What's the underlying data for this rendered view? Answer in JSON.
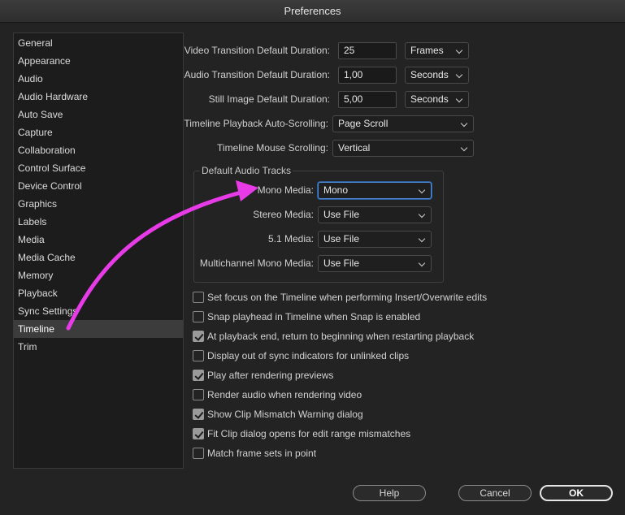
{
  "window": {
    "title": "Preferences"
  },
  "sidebar": {
    "items": [
      {
        "label": "General"
      },
      {
        "label": "Appearance"
      },
      {
        "label": "Audio"
      },
      {
        "label": "Audio Hardware"
      },
      {
        "label": "Auto Save"
      },
      {
        "label": "Capture"
      },
      {
        "label": "Collaboration"
      },
      {
        "label": "Control Surface"
      },
      {
        "label": "Device Control"
      },
      {
        "label": "Graphics"
      },
      {
        "label": "Labels"
      },
      {
        "label": "Media"
      },
      {
        "label": "Media Cache"
      },
      {
        "label": "Memory"
      },
      {
        "label": "Playback"
      },
      {
        "label": "Sync Settings"
      },
      {
        "label": "Timeline"
      },
      {
        "label": "Trim"
      }
    ],
    "selected": "Timeline"
  },
  "durations": {
    "video_transition": {
      "label": "Video Transition Default Duration:",
      "value": "25",
      "unit": "Frames"
    },
    "audio_transition": {
      "label": "Audio Transition Default Duration:",
      "value": "1,00",
      "unit": "Seconds"
    },
    "still_image": {
      "label": "Still Image Default Duration:",
      "value": "5,00",
      "unit": "Seconds"
    }
  },
  "scrolling": {
    "auto_scrolling": {
      "label": "Timeline Playback Auto-Scrolling:",
      "value": "Page Scroll"
    },
    "mouse_scrolling": {
      "label": "Timeline Mouse Scrolling:",
      "value": "Vertical"
    }
  },
  "audio_tracks": {
    "title": "Default Audio Tracks",
    "mono": {
      "label": "Mono Media:",
      "value": "Mono"
    },
    "stereo": {
      "label": "Stereo Media:",
      "value": "Use File"
    },
    "five_one": {
      "label": "5.1 Media:",
      "value": "Use File"
    },
    "multichannel": {
      "label": "Multichannel Mono Media:",
      "value": "Use File"
    }
  },
  "options": [
    {
      "label": "Set focus on the Timeline when performing Insert/Overwrite edits",
      "checked": false
    },
    {
      "label": "Snap playhead in Timeline when Snap is enabled",
      "checked": false
    },
    {
      "label": "At playback end, return to beginning when restarting playback",
      "checked": true
    },
    {
      "label": "Display out of sync indicators for unlinked clips",
      "checked": false
    },
    {
      "label": "Play after rendering previews",
      "checked": true
    },
    {
      "label": "Render audio when rendering video",
      "checked": false
    },
    {
      "label": "Show Clip Mismatch Warning dialog",
      "checked": true
    },
    {
      "label": "Fit Clip dialog opens for edit range mismatches",
      "checked": true
    },
    {
      "label": "Match frame sets in point",
      "checked": false
    }
  ],
  "buttons": {
    "help": "Help",
    "cancel": "Cancel",
    "ok": "OK"
  },
  "annotation": {
    "arrow_color": "#e83be8"
  }
}
